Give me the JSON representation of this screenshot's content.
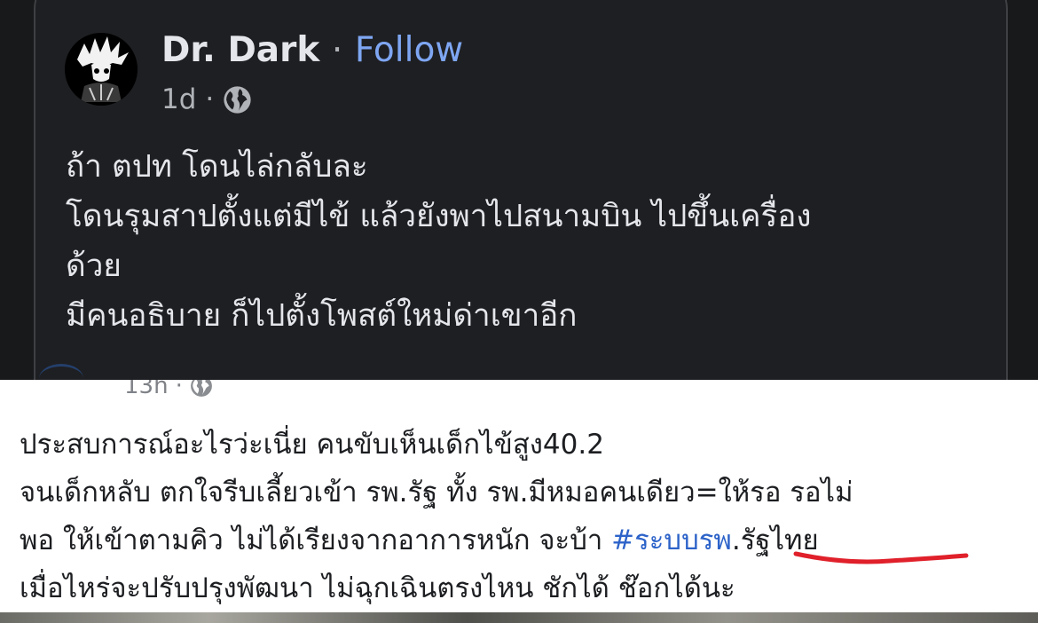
{
  "post": {
    "author": "Dr. Dark",
    "separator": "·",
    "follow_label": "Follow",
    "time": "1d",
    "meta_separator": "·",
    "visibility_icon": "globe-icon",
    "lines": [
      "ถ้า ตปท โดนไล่กลับละ",
      "โดนรุมสาปตั้งแต่มีไข้ แล้วยังพาไปสนามบิน ไปขึ้นเครื่อง",
      "ด้วย",
      "มีคนอธิบาย ก็ไปตั้งโพสต์ใหม่ด่าเขาอีก"
    ]
  },
  "shared": {
    "time": "13h",
    "meta_separator": "·",
    "visibility_icon": "globe-icon",
    "line1": "ประสบการณ์อะไรว่ะเนี่ย คนขับเห็นเด็กไข้สูง40.2",
    "line2": "จนเด็กหลับ ตกใจรีบเลี้ยวเข้า รพ.รัฐ ทั้ง รพ.มีหมอคนเดียว=ให้รอ รอไม่",
    "line3_before": "พอ ให้เข้าตามคิว ไม่ได้เรียงจากอาการหนัก จะบ้า ",
    "line3_hashtag": "#ระบบรพ",
    "line3_after": ".รัฐไทย",
    "line4": "เมื่อไหร่จะปรับปรุงพัฒนา ไม่ฉุกเฉินตรงไหน ชักได้ ช๊อกได้นะ"
  },
  "colors": {
    "dark_bg": "#18191b",
    "card_bg": "#1e1f22",
    "follow_blue": "#7ea6f2",
    "hashtag_blue": "#2d63c9",
    "underline_red": "#e0202a"
  }
}
